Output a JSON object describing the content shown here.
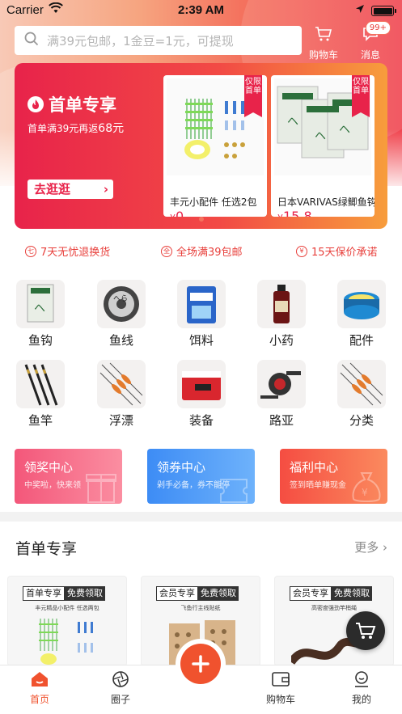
{
  "status_bar": {
    "carrier": "Carrier",
    "time": "2:39 AM"
  },
  "search": {
    "placeholder": "满39元包邮，1金豆=1元，可提现"
  },
  "top_actions": {
    "cart_label": "购物车",
    "message_label": "消息",
    "message_badge": "99+"
  },
  "banner": {
    "title": "首单专享",
    "subtitle_prefix": "首单满39元再返",
    "subtitle_amount": "68元",
    "button_label": "去逛逛",
    "products": [
      {
        "ribbon": "仅限首单",
        "name": "丰元小配件 任选2包",
        "currency": "¥",
        "price": "0"
      },
      {
        "ribbon": "仅限首单",
        "name": "日本VARIVAS绿鲫鱼钩",
        "currency": "¥",
        "price": "15.8"
      }
    ]
  },
  "promises": [
    {
      "icon": "七",
      "label": "7天无忧退换货"
    },
    {
      "icon": "全",
      "label": "全场满39包邮"
    },
    {
      "icon": "¥",
      "label": "15天保价承诺"
    }
  ],
  "categories": [
    {
      "label": "鱼钩",
      "icon": "hook-pack-icon"
    },
    {
      "label": "鱼线",
      "icon": "line-spool-icon"
    },
    {
      "label": "饵料",
      "icon": "bait-bag-icon"
    },
    {
      "label": "小药",
      "icon": "bottle-icon"
    },
    {
      "label": "配件",
      "icon": "reel-accessory-icon"
    },
    {
      "label": "鱼竿",
      "icon": "rod-icon"
    },
    {
      "label": "浮漂",
      "icon": "float-icon"
    },
    {
      "label": "装备",
      "icon": "cooler-box-icon"
    },
    {
      "label": "路亚",
      "icon": "lure-reel-icon"
    },
    {
      "label": "分类",
      "icon": "category-icon"
    }
  ],
  "centers": [
    {
      "title": "领奖中心",
      "subtitle": "中奖啦，快来领",
      "color": "#f3577a"
    },
    {
      "title": "领券中心",
      "subtitle": "剁手必备，券不能停",
      "color": "#3d8cf5"
    },
    {
      "title": "福利中心",
      "subtitle": "签到晒单赚现金",
      "color": "#f54d42"
    }
  ],
  "section": {
    "title": "首单专享",
    "more": "更多"
  },
  "bottom_cards": [
    {
      "tag": "首单专享",
      "tag2": "免费领取",
      "caption": "丰元精品小配件  任选两包"
    },
    {
      "tag": "会员专享",
      "tag2": "免费领取",
      "caption": "飞鱼行主线贴纸"
    },
    {
      "tag": "会员专享",
      "tag2": "免费领取",
      "caption": "高密度强劲竿梢绳"
    }
  ],
  "tabbar": [
    {
      "label": "首页",
      "active": true
    },
    {
      "label": "圈子",
      "active": false
    },
    {
      "label": "购物车",
      "active": false
    },
    {
      "label": "我的",
      "active": false
    }
  ],
  "colors": {
    "accent": "#f0522e",
    "red": "#e8234a"
  }
}
